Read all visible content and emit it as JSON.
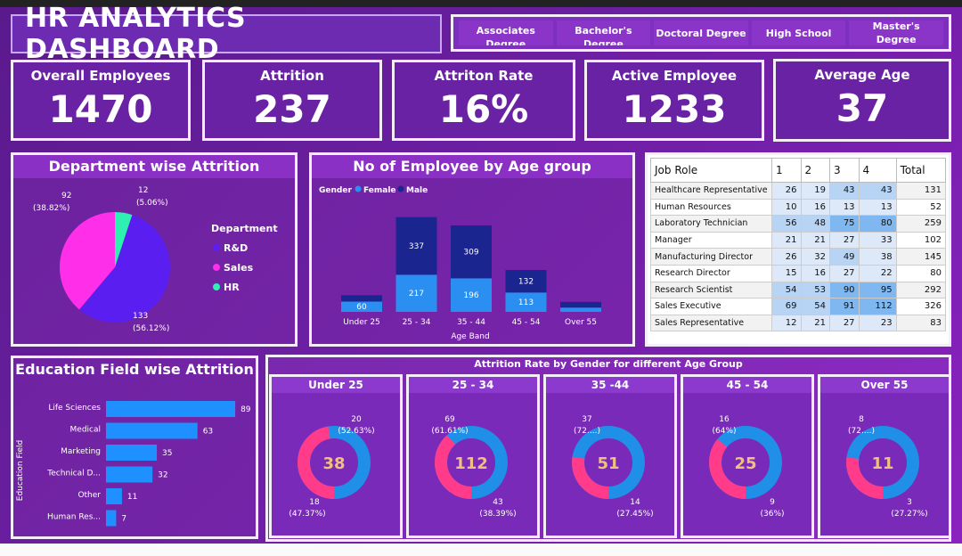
{
  "header": {
    "title": "HR ANALYTICS DASHBOARD"
  },
  "slicer": {
    "options": [
      "Associates Degree",
      "Bachelor's Degree",
      "Doctoral Degree",
      "High School",
      "Master's Degree"
    ]
  },
  "kpis": [
    {
      "label": "Overall Employees",
      "value": "1470"
    },
    {
      "label": "Attrition",
      "value": "237"
    },
    {
      "label": "Attriton Rate",
      "value": "16%"
    },
    {
      "label": "Active Employee",
      "value": "1233"
    },
    {
      "label": "Average Age",
      "value": "37"
    }
  ],
  "colors": {
    "rd": "#5a1ef0",
    "sales": "#ff2ee8",
    "hr": "#2ef0b0",
    "female": "#2a8ff0",
    "male": "#1a2590",
    "donut_a": "#1f8fe8",
    "donut_b": "#ff3b8a",
    "bar": "#1e90ff"
  },
  "dept": {
    "title": "Department wise Attrition",
    "legend_title": "Department",
    "labels": [
      {
        "value": "92",
        "pct": "(38.82%)"
      },
      {
        "value": "12",
        "pct": "(5.06%)"
      },
      {
        "value": "133",
        "pct": "(56.12%)"
      }
    ]
  },
  "age": {
    "title": "No of Employee by Age group",
    "legend_title": "Gender",
    "xlabel": "Age Band"
  },
  "jobs": {
    "headers": [
      "Job Role",
      "1",
      "2",
      "3",
      "4",
      "Total"
    ],
    "rows": [
      [
        "Healthcare Representative",
        "26",
        "19",
        "43",
        "43",
        "131"
      ],
      [
        "Human Resources",
        "10",
        "16",
        "13",
        "13",
        "52"
      ],
      [
        "Laboratory Technician",
        "56",
        "48",
        "75",
        "80",
        "259"
      ],
      [
        "Manager",
        "21",
        "21",
        "27",
        "33",
        "102"
      ],
      [
        "Manufacturing Director",
        "26",
        "32",
        "49",
        "38",
        "145"
      ],
      [
        "Research Director",
        "15",
        "16",
        "27",
        "22",
        "80"
      ],
      [
        "Research Scientist",
        "54",
        "53",
        "90",
        "95",
        "292"
      ],
      [
        "Sales Executive",
        "69",
        "54",
        "91",
        "112",
        "326"
      ],
      [
        "Sales Representative",
        "12",
        "21",
        "27",
        "23",
        "83"
      ]
    ]
  },
  "edu": {
    "title": "Education Field wise Attrition",
    "ylabel": "Education Field"
  },
  "gender": {
    "title": "Attrition Rate by Gender for different Age Group",
    "groups": [
      {
        "label": "Under 25",
        "total": "38",
        "a": "20",
        "a_pct": "(52.63%)",
        "b": "18",
        "b_pct": "(47.37%)",
        "b_frac": 0.4737
      },
      {
        "label": "25 - 34",
        "total": "112",
        "a": "69",
        "a_pct": "(61.61%)",
        "b": "43",
        "b_pct": "(38.39%)",
        "b_frac": 0.3839
      },
      {
        "label": "35 -44",
        "total": "51",
        "a": "37",
        "a_pct": "(72....)",
        "b": "14",
        "b_pct": "(27.45%)",
        "b_frac": 0.2745
      },
      {
        "label": "45 - 54",
        "total": "25",
        "a": "16",
        "a_pct": "(64%)",
        "b": "9",
        "b_pct": "(36%)",
        "b_frac": 0.36
      },
      {
        "label": "Over 55",
        "total": "11",
        "a": "8",
        "a_pct": "(72....)",
        "b": "3",
        "b_pct": "(27.27%)",
        "b_frac": 0.2727
      }
    ]
  },
  "chart_data": [
    {
      "type": "pie",
      "title": "Department wise Attrition",
      "categories": [
        "R&D",
        "Sales",
        "HR"
      ],
      "values": [
        133,
        92,
        12
      ]
    },
    {
      "type": "bar",
      "title": "No of Employee by Age group",
      "xlabel": "Age Band",
      "categories": [
        "Under 25",
        "25 - 34",
        "35 - 44",
        "45 - 54",
        "Over 55"
      ],
      "series": [
        {
          "name": "Female",
          "values": [
            60,
            217,
            196,
            113,
            25
          ]
        },
        {
          "name": "Male",
          "values": [
            37,
            337,
            309,
            132,
            33
          ]
        }
      ],
      "ylim": [
        0,
        600
      ]
    },
    {
      "type": "bar",
      "title": "Education Field wise Attrition",
      "ylabel": "Education Field",
      "categories": [
        "Life Sciences",
        "Medical",
        "Marketing",
        "Technical D...",
        "Other",
        "Human Res..."
      ],
      "values": [
        89,
        63,
        35,
        32,
        11,
        7
      ]
    }
  ]
}
